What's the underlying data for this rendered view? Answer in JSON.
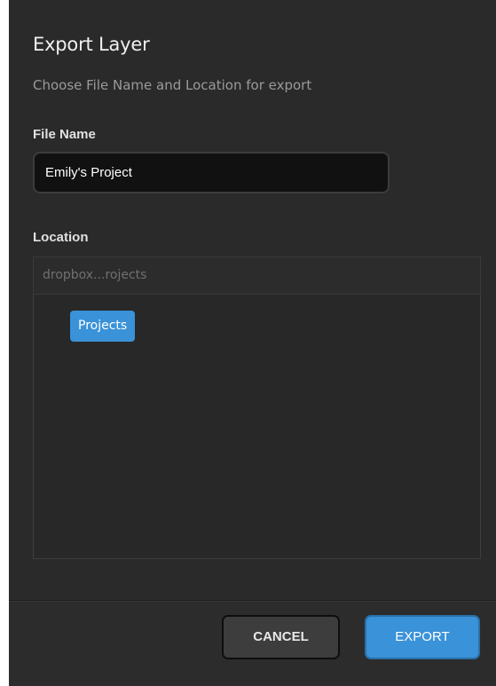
{
  "dialog": {
    "title": "Export Layer",
    "subtitle": "Choose File Name and Location for export"
  },
  "file_name": {
    "label": "File Name",
    "value": "Emily's Project"
  },
  "location": {
    "label": "Location",
    "path": "dropbox...rojects",
    "folders": [
      {
        "label": "Projects",
        "selected": true
      }
    ]
  },
  "buttons": {
    "cancel_label": "CANCEL",
    "export_label": "EXPORT"
  },
  "colors": {
    "background": "#2a2a2a",
    "accent": "#3a92d8",
    "input_background": "#111111"
  }
}
